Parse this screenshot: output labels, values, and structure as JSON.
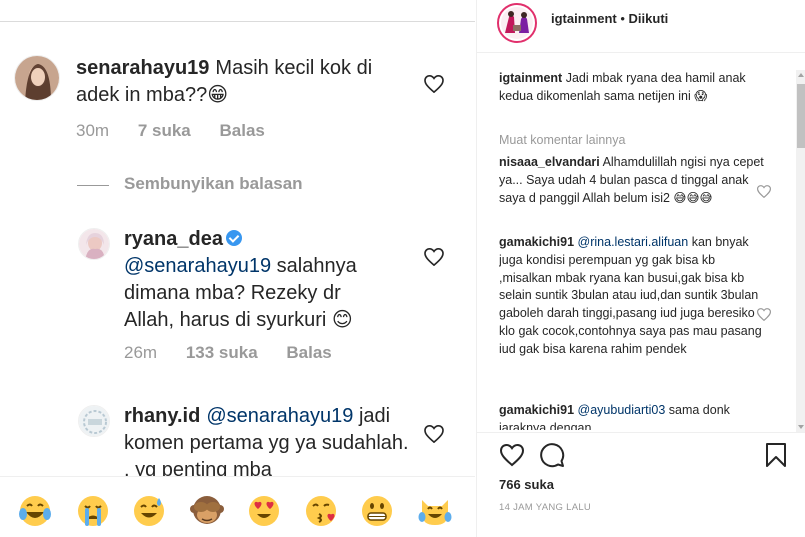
{
  "left_pane": {
    "comments": [
      {
        "username": "senarahayu19",
        "text": "Masih kecil kok di adek in mba??😁",
        "time": "30m",
        "likes": "7 suka",
        "reply": "Balas"
      }
    ],
    "hide_replies": "Sembunyikan balasan",
    "replies": [
      {
        "username": "ryana_dea",
        "verified": true,
        "mention": "@senarahayu19",
        "text": "salahnya dimana mba? Rezeky dr Allah, harus di syurkuri 😊",
        "time": "26m",
        "likes": "133 suka",
        "reply": "Balas"
      },
      {
        "username": "rhany.id",
        "mention": "@senarahayu19",
        "text": "jadi komen pertama yg ya sudahlah. . yg penting mba"
      }
    ],
    "emoji_bar": [
      "😂",
      "😭",
      "😅",
      "🙈",
      "😍",
      "😘",
      "😁",
      "😹"
    ]
  },
  "post": {
    "account": "igtainment",
    "separator": "•",
    "follow_status": "Diikuti",
    "caption": {
      "username": "igtainment",
      "text": "Jadi mbak ryana dea hamil anak kedua dikomenlah sama netijen ini 😱"
    },
    "load_more": "Muat komentar lainnya",
    "comments": [
      {
        "username": "nisaaa_elvandari",
        "text": "Alhamdulillah ngisi nya cepet ya... Saya udah 4 bulan pasca d tinggal anak saya d panggil Allah belum isi2 😅😅😅"
      },
      {
        "username": "gamakichi91",
        "mention": "@rina.lestari.alifuan",
        "text": "kan bnyak juga kondisi perempuan yg gak bisa kb ,misalkan mbak ryana kan busui,gak bisa kb selain suntik 3bulan atau iud,dan suntik 3bulan gaboleh darah tinggi,pasang iud juga beresiko klo gak cocok,contohnya saya pas mau pasang iud gak bisa karena rahim pendek"
      },
      {
        "username": "gamakichi91",
        "mention": "@ayubudiarti03",
        "text": "sama donk jaraknya dengan"
      }
    ],
    "likes": "766 suka",
    "time_ago": "14 JAM YANG LALU",
    "icons": {
      "like": "heart-icon",
      "comment": "comment-icon",
      "save": "bookmark-icon"
    }
  },
  "colors": {
    "text": "#262626",
    "secondary": "#999999",
    "mention": "#003569",
    "verified": "#3897f0",
    "border": "#efefef"
  }
}
